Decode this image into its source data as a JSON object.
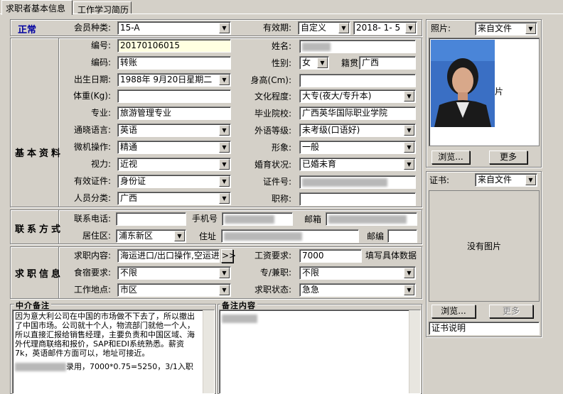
{
  "tabs": [
    "求职者基本信息",
    "工作学习简历"
  ],
  "status": "正常",
  "sections": {
    "basic": "基本资料",
    "contact": "联系方式",
    "job": "求职信息"
  },
  "member_type": {
    "label": "会员种类:",
    "value": "15-A"
  },
  "validity": {
    "label": "有效期:",
    "mode": "自定义",
    "date": "2018- 1- 5"
  },
  "fields": {
    "number": {
      "label": "编号:",
      "value": "20170106015"
    },
    "name": {
      "label": "姓名:"
    },
    "code": {
      "label": "编码:",
      "value": "转账"
    },
    "gender": {
      "label": "性别:",
      "value": "女"
    },
    "native": {
      "label": "籍贯",
      "value": "广西"
    },
    "birth": {
      "label": "出生日期:",
      "value": "1988年 9月20日星期二"
    },
    "height": {
      "label": "身高(Cm):",
      "value": ""
    },
    "weight": {
      "label": "体重(Kg):",
      "value": ""
    },
    "education": {
      "label": "文化程度:",
      "value": "大专(夜大/专升本)"
    },
    "major": {
      "label": "专业:",
      "value": "旅游管理专业"
    },
    "school": {
      "label": "毕业院校:",
      "value": "广西英华国际职业学院"
    },
    "language": {
      "label": "通晓语言:",
      "value": "英语"
    },
    "lang_level": {
      "label": "外语等级:",
      "value": "未考级(口语好)"
    },
    "computer": {
      "label": "微机操作:",
      "value": "精通"
    },
    "appearance": {
      "label": "形象:",
      "value": "一般"
    },
    "vision": {
      "label": "视力:",
      "value": "近视"
    },
    "marital": {
      "label": "婚育状况:",
      "value": "已婚未育"
    },
    "id_type": {
      "label": "有效证件:",
      "value": "身份证"
    },
    "id_no": {
      "label": "证件号:"
    },
    "category": {
      "label": "人员分类:",
      "value": "广西"
    },
    "title": {
      "label": "职称:",
      "value": ""
    }
  },
  "contact": {
    "phone": {
      "label": "联系电话:",
      "value": ""
    },
    "mobile": {
      "label": "手机号"
    },
    "email": {
      "label": "邮箱"
    },
    "district": {
      "label": "居住区:",
      "value": "浦东新区"
    },
    "address": {
      "label": "住址"
    },
    "zip": {
      "label": "邮编",
      "value": ""
    }
  },
  "job": {
    "content": {
      "label": "求职内容:",
      "value": "海运进口/出口操作,空运进",
      "more": ">>"
    },
    "salary": {
      "label": "工资要求:",
      "value": "7000",
      "note": "填写具体数据"
    },
    "lodging": {
      "label": "食宿要求:",
      "value": "不限"
    },
    "fulltime": {
      "label": "专/兼职:",
      "value": "不限"
    },
    "location": {
      "label": "工作地点:",
      "value": "市区"
    },
    "state": {
      "label": "求职状态:",
      "value": "急急"
    }
  },
  "notes": {
    "agent_label": "中介备注",
    "agent_text": "因为意大利公司在中国的市场做不下去了，所以撤出了中国市场。公司就十个人，物流部门就他一个人，所以直接汇报给销售经理，主要负责和中国区域、海外代理商联络和报价，SAP和EDI系统熟悉。薪资7k，英语邮件方面可以，地址可接近。",
    "agent_tail": "录用，7000*0.75=5250，3/1入职",
    "remark_label": "备注内容"
  },
  "photo": {
    "label": "照片:",
    "source": "来自文件",
    "browse": "浏览...",
    "more": "更多"
  },
  "cert": {
    "label": "证书:",
    "source": "来自文件",
    "placeholder": "没有图片",
    "browse": "浏览...",
    "more": "更多",
    "desc": "证书说明"
  },
  "colors": {
    "accent": "#0000a0",
    "window": "#d4d0c8",
    "yellow_field": "#ffffe1"
  }
}
